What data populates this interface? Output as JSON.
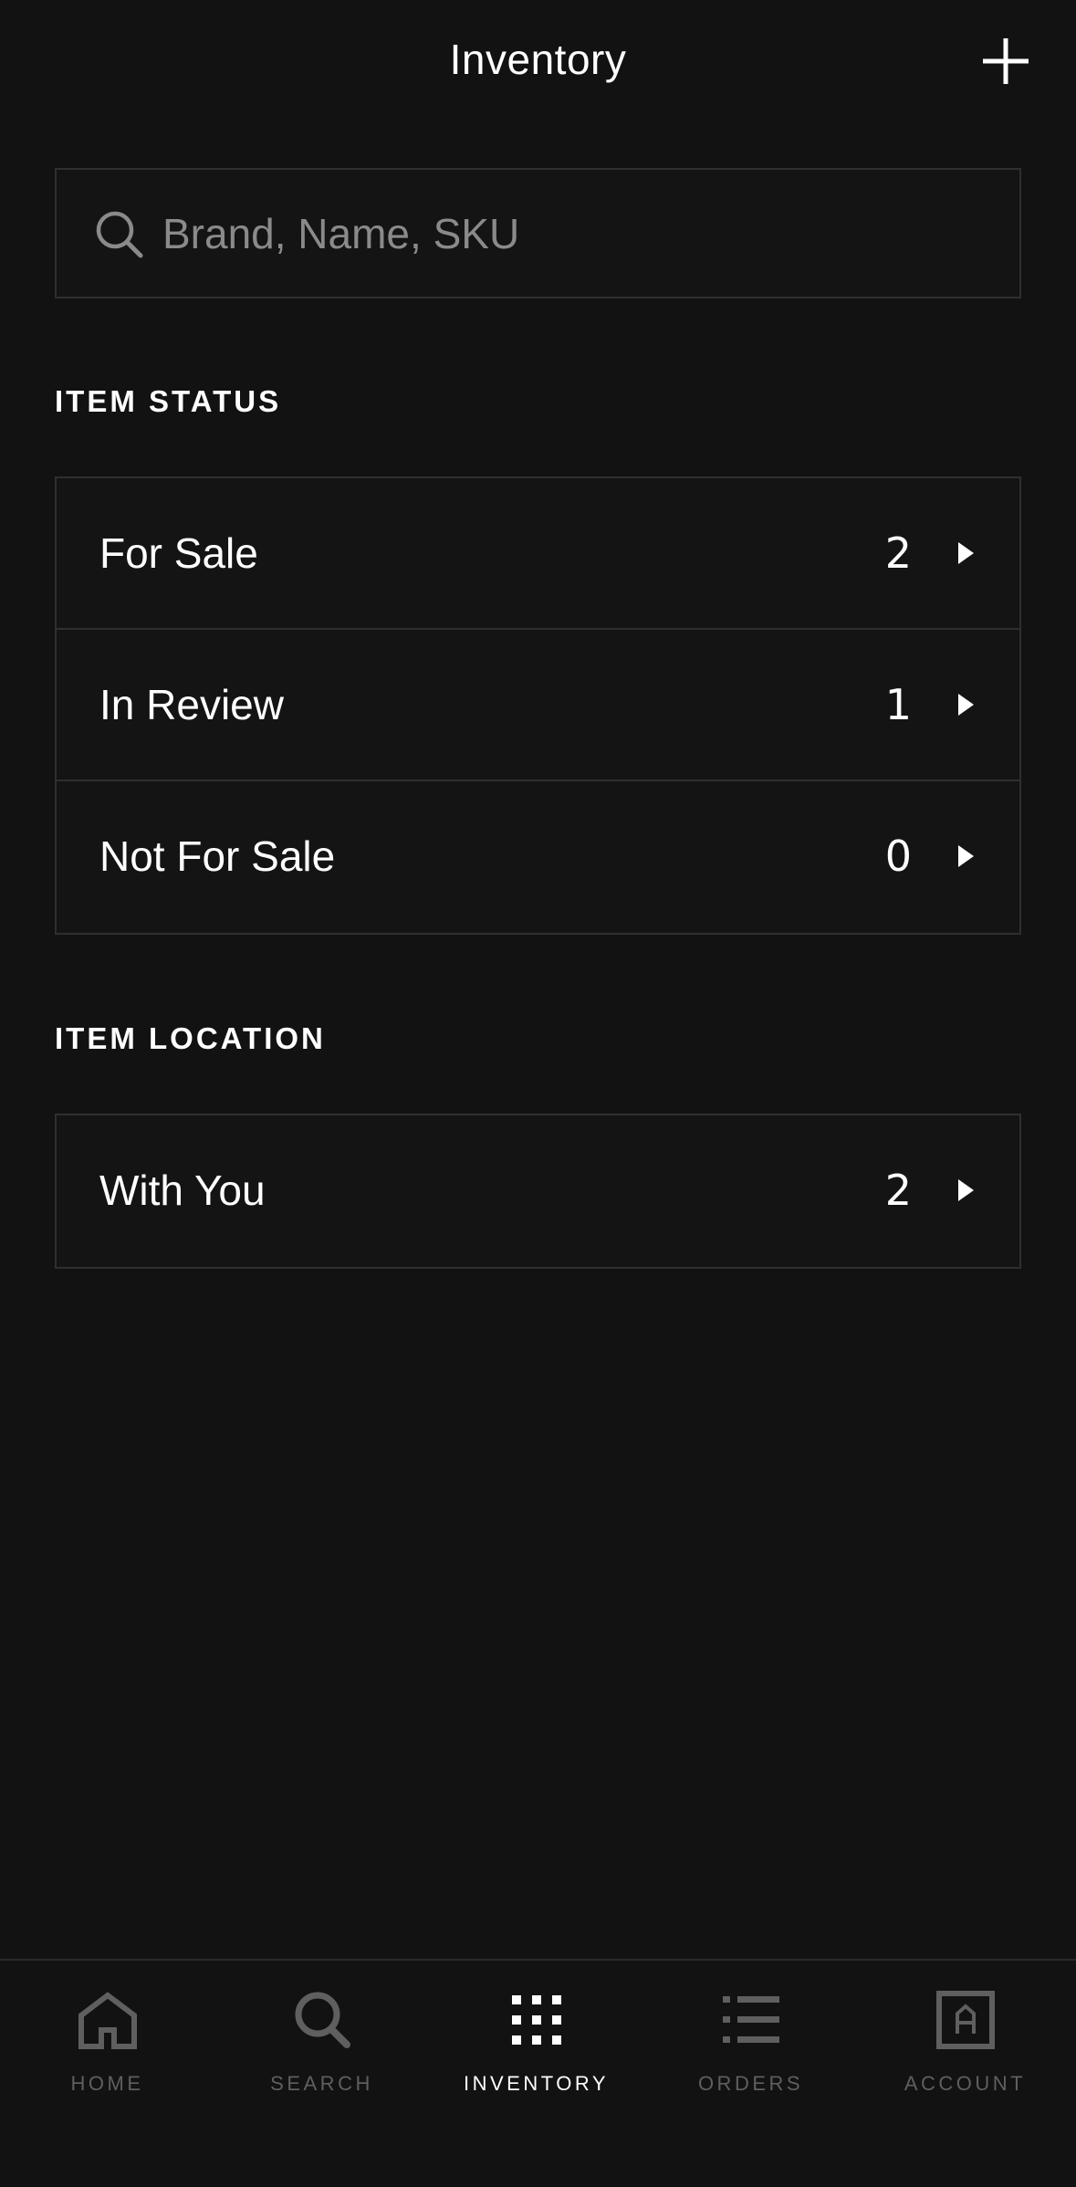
{
  "header": {
    "title": "Inventory",
    "add_icon": "plus-icon"
  },
  "search": {
    "placeholder": "Brand, Name, SKU",
    "value": "",
    "icon": "search-icon"
  },
  "item_status": {
    "title": "ITEM STATUS",
    "rows": [
      {
        "label": "For Sale",
        "count": "2"
      },
      {
        "label": "In Review",
        "count": "1"
      },
      {
        "label": "Not For Sale",
        "count": "0"
      }
    ]
  },
  "item_location": {
    "title": "ITEM LOCATION",
    "rows": [
      {
        "label": "With You",
        "count": "2"
      }
    ]
  },
  "nav": {
    "items": [
      {
        "label": "HOME",
        "icon": "home-icon",
        "active": false
      },
      {
        "label": "SEARCH",
        "icon": "search-icon",
        "active": false
      },
      {
        "label": "INVENTORY",
        "icon": "grid-icon",
        "active": true
      },
      {
        "label": "ORDERS",
        "icon": "list-icon",
        "active": false
      },
      {
        "label": "ACCOUNT",
        "icon": "account-icon",
        "active": false
      }
    ]
  },
  "colors": {
    "background": "#121212",
    "border": "#2f2f2f",
    "text": "#ffffff",
    "muted": "#8a8a8a",
    "nav_inactive": "#5f5f5f"
  }
}
